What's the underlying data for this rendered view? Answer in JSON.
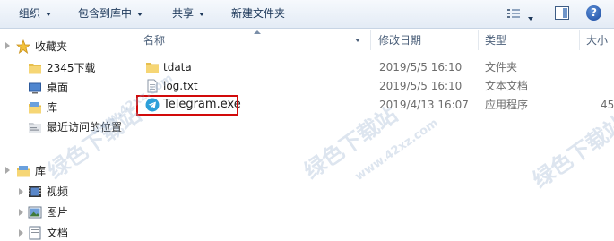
{
  "toolbar": {
    "organize": "组织",
    "include_in_library": "包含到库中",
    "share": "共享",
    "new_folder": "新建文件夹",
    "help": "?"
  },
  "nav": {
    "favorites": "收藏夹",
    "items": [
      {
        "label": "2345下载",
        "icon": "folder-icon"
      },
      {
        "label": "桌面",
        "icon": "desktop-icon"
      },
      {
        "label": "库",
        "icon": "library-icon"
      },
      {
        "label": "最近访问的位置",
        "icon": "recent-places-icon"
      }
    ],
    "library": "库",
    "library_items": [
      {
        "label": "视频",
        "icon": "video-icon"
      },
      {
        "label": "图片",
        "icon": "picture-icon"
      },
      {
        "label": "文档",
        "icon": "document-icon"
      }
    ]
  },
  "columns": {
    "name": "名称",
    "modified": "修改日期",
    "type": "类型",
    "size": "大小"
  },
  "files": [
    {
      "name": "tdata",
      "modified": "2019/5/5 16:10",
      "type": "文件夹",
      "size": "",
      "icon": "folder-icon"
    },
    {
      "name": "log.txt",
      "modified": "2019/5/5 16:10",
      "type": "文本文档",
      "size": "",
      "icon": "text-file-icon"
    },
    {
      "name": "Telegram.exe",
      "modified": "2019/4/13 16:07",
      "type": "应用程序",
      "size": "45",
      "icon": "telegram-icon"
    }
  ],
  "watermark": {
    "brand": "绿色下载站",
    "domain": "www.42xz.com"
  }
}
